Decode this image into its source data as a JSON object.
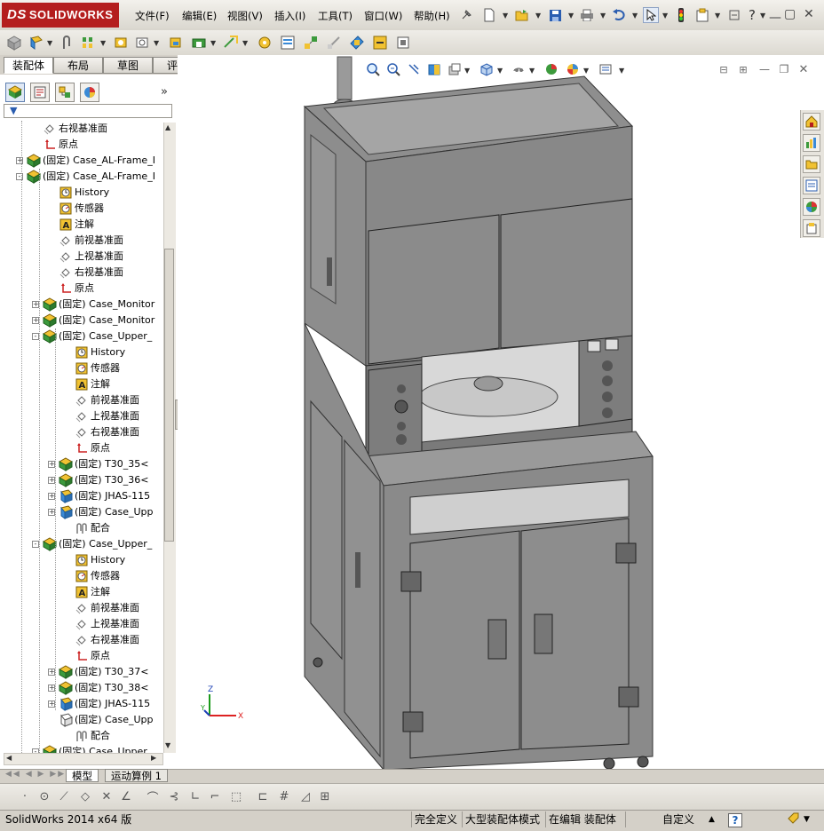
{
  "app": {
    "logo_prefix": "DS",
    "logo_text": "SOLIDWORKS"
  },
  "menu": [
    "文件(F)",
    "编辑(E)",
    "视图(V)",
    "插入(I)",
    "工具(T)",
    "窗口(W)",
    "帮助(H)"
  ],
  "tabs": [
    {
      "label": "装配体",
      "active": true
    },
    {
      "label": "布局"
    },
    {
      "label": "草图"
    },
    {
      "label": "评估"
    }
  ],
  "tree": {
    "items": [
      {
        "depth": 2,
        "icon": "plane-icon",
        "label": "右视基准面",
        "expander": ""
      },
      {
        "depth": 2,
        "icon": "origin-icon",
        "label": "原点",
        "expander": ""
      },
      {
        "depth": 1,
        "icon": "assembly-icon",
        "label": "(固定) Case_AL-Frame_I",
        "expander": "+"
      },
      {
        "depth": 1,
        "icon": "assembly-icon",
        "label": "(固定) Case_AL-Frame_I",
        "expander": "-"
      },
      {
        "depth": 3,
        "icon": "history-icon",
        "label": "History",
        "expander": ""
      },
      {
        "depth": 3,
        "icon": "sensor-icon",
        "label": "传感器",
        "expander": ""
      },
      {
        "depth": 3,
        "icon": "annotation-icon",
        "label": "注解",
        "expander": ""
      },
      {
        "depth": 3,
        "icon": "plane-icon",
        "label": "前视基准面",
        "expander": ""
      },
      {
        "depth": 3,
        "icon": "plane-icon",
        "label": "上视基准面",
        "expander": ""
      },
      {
        "depth": 3,
        "icon": "plane-icon",
        "label": "右视基准面",
        "expander": ""
      },
      {
        "depth": 3,
        "icon": "origin-icon",
        "label": "原点",
        "expander": ""
      },
      {
        "depth": 2,
        "icon": "assembly-icon",
        "label": "(固定) Case_Monitor",
        "expander": "+"
      },
      {
        "depth": 2,
        "icon": "assembly-icon",
        "label": "(固定) Case_Monitor",
        "expander": "+"
      },
      {
        "depth": 2,
        "icon": "assembly-icon",
        "label": "(固定) Case_Upper_",
        "expander": "-"
      },
      {
        "depth": 4,
        "icon": "history-icon",
        "label": "History",
        "expander": ""
      },
      {
        "depth": 4,
        "icon": "sensor-icon",
        "label": "传感器",
        "expander": ""
      },
      {
        "depth": 4,
        "icon": "annotation-icon",
        "label": "注解",
        "expander": ""
      },
      {
        "depth": 4,
        "icon": "plane-icon",
        "label": "前视基准面",
        "expander": ""
      },
      {
        "depth": 4,
        "icon": "plane-icon",
        "label": "上视基准面",
        "expander": ""
      },
      {
        "depth": 4,
        "icon": "plane-icon",
        "label": "右视基准面",
        "expander": ""
      },
      {
        "depth": 4,
        "icon": "origin-icon",
        "label": "原点",
        "expander": ""
      },
      {
        "depth": 3,
        "icon": "assembly-icon",
        "label": "(固定) T30_35<",
        "expander": "+"
      },
      {
        "depth": 3,
        "icon": "assembly-icon",
        "label": "(固定) T30_36<",
        "expander": "+"
      },
      {
        "depth": 3,
        "icon": "part-icon",
        "label": "(固定) JHAS-115",
        "expander": "+"
      },
      {
        "depth": 3,
        "icon": "part-icon",
        "label": "(固定) Case_Upp",
        "expander": "+"
      },
      {
        "depth": 4,
        "icon": "mates-icon",
        "label": "配合",
        "expander": ""
      },
      {
        "depth": 2,
        "icon": "assembly-icon",
        "label": "(固定) Case_Upper_",
        "expander": "-"
      },
      {
        "depth": 4,
        "icon": "history-icon",
        "label": "History",
        "expander": ""
      },
      {
        "depth": 4,
        "icon": "sensor-icon",
        "label": "传感器",
        "expander": ""
      },
      {
        "depth": 4,
        "icon": "annotation-icon",
        "label": "注解",
        "expander": ""
      },
      {
        "depth": 4,
        "icon": "plane-icon",
        "label": "前视基准面",
        "expander": ""
      },
      {
        "depth": 4,
        "icon": "plane-icon",
        "label": "上视基准面",
        "expander": ""
      },
      {
        "depth": 4,
        "icon": "plane-icon",
        "label": "右视基准面",
        "expander": ""
      },
      {
        "depth": 4,
        "icon": "origin-icon",
        "label": "原点",
        "expander": ""
      },
      {
        "depth": 3,
        "icon": "assembly-icon",
        "label": "(固定) T30_37<",
        "expander": "+"
      },
      {
        "depth": 3,
        "icon": "assembly-icon",
        "label": "(固定) T30_38<",
        "expander": "+"
      },
      {
        "depth": 3,
        "icon": "part-icon",
        "label": "(固定) JHAS-115",
        "expander": "+"
      },
      {
        "depth": 3,
        "icon": "part-outline-icon",
        "label": "(固定) Case_Upp",
        "expander": ""
      },
      {
        "depth": 4,
        "icon": "mates-icon",
        "label": "配合",
        "expander": ""
      },
      {
        "depth": 2,
        "icon": "assembly-icon",
        "label": "(固定) Case_Upper",
        "expander": "-"
      }
    ]
  },
  "bottom_tabs": [
    "模型",
    "运动算例 1"
  ],
  "axis_labels": {
    "x": "X",
    "y": "Y",
    "z": "Z"
  },
  "status": {
    "app_version": "SolidWorks 2014 x64 版",
    "definition": "完全定义",
    "mode": "大型装配体模式",
    "editing": "在编辑 装配体",
    "units": "自定义",
    "help": "?"
  },
  "colors": {
    "brand": "#b41e1e",
    "model_gray": "#8a8a8a",
    "graphics_bg": "#ffffff"
  }
}
